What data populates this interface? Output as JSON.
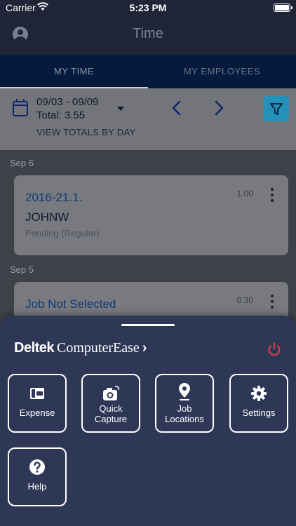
{
  "status_bar": {
    "carrier": "Carrier",
    "time": "5:23 PM"
  },
  "header": {
    "title": "Time"
  },
  "tabs": [
    {
      "label": "MY TIME",
      "active": true
    },
    {
      "label": "MY EMPLOYEES",
      "active": false
    }
  ],
  "filter": {
    "date_range": "09/03 - 09/09",
    "total": "Total: 3.55",
    "view_totals": "VIEW TOTALS BY DAY"
  },
  "entries": [
    {
      "day": "Sep 6",
      "job": "2016-21.1.",
      "user": "JOHNW",
      "status": "Pending (Regular)",
      "hours": "1.00"
    },
    {
      "day": "Sep 5",
      "job": "Job Not Selected",
      "hours": "0.30"
    }
  ],
  "menu": {
    "brand_deltek": "Deltek",
    "brand_product": "ComputerEase",
    "tiles": [
      {
        "label": "Expense",
        "icon": "wallet-icon"
      },
      {
        "label": "Quick Capture",
        "icon": "camera-icon"
      },
      {
        "label": "Job Locations",
        "icon": "location-pin-icon"
      },
      {
        "label": "Settings",
        "icon": "gear-icon"
      },
      {
        "label": "Help",
        "icon": "help-icon"
      }
    ]
  },
  "colors": {
    "accent": "#2590b8",
    "sheet": "#2f3757",
    "power": "#e0413c",
    "job_link": "#0d3a72"
  }
}
